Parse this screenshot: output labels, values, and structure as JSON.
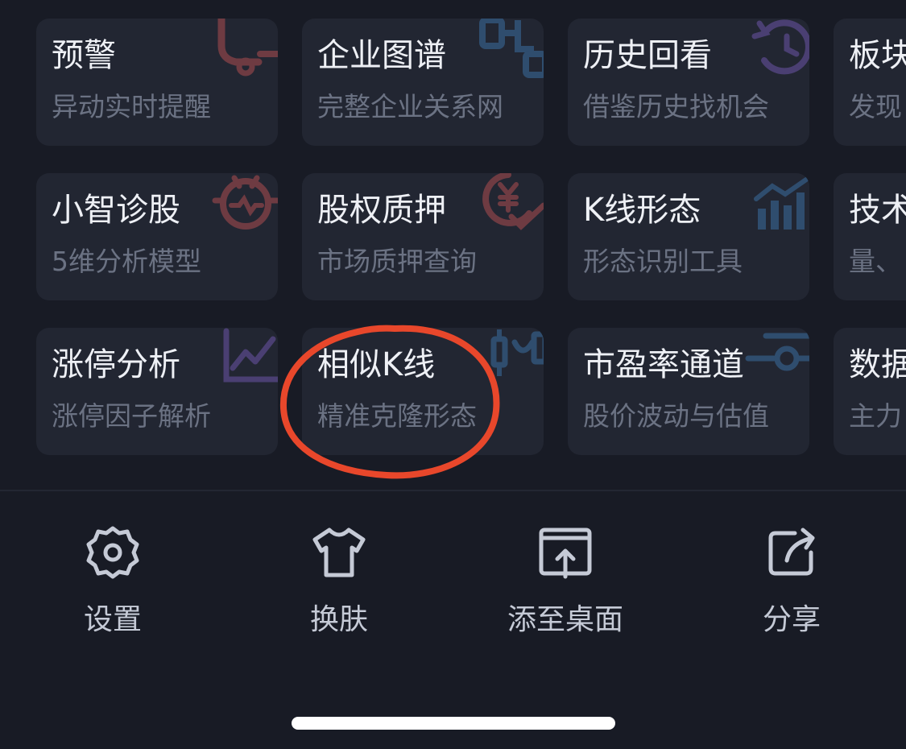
{
  "tools": [
    {
      "title": "预警",
      "subtitle": "异动实时提醒",
      "icon": "bell-icon",
      "icon_color": "#6e3b42"
    },
    {
      "title": "企业图谱",
      "subtitle": "完整企业关系网",
      "icon": "network-graph-icon",
      "icon_color": "#2f4d6e"
    },
    {
      "title": "历史回看",
      "subtitle": "借鉴历史找机会",
      "icon": "history-clock-icon",
      "icon_color": "#4a3f72"
    },
    {
      "title": "板块",
      "subtitle": "发现",
      "icon": "sector-icon",
      "icon_color": "#2f4d6e"
    },
    {
      "title": "小智诊股",
      "subtitle": "5维分析模型",
      "icon": "robot-face-icon",
      "icon_color": "#6e3b42"
    },
    {
      "title": "股权质押",
      "subtitle": "市场质押查询",
      "icon": "yuan-pledge-icon",
      "icon_color": "#6e3b42"
    },
    {
      "title": "K线形态",
      "subtitle": "形态识别工具",
      "icon": "bar-trend-icon",
      "icon_color": "#2f4d6e"
    },
    {
      "title": "技术",
      "subtitle": "量、",
      "icon": "technical-icon",
      "icon_color": "#2f4d6e"
    },
    {
      "title": "涨停分析",
      "subtitle": "涨停因子解析",
      "icon": "line-chart-icon",
      "icon_color": "#4a3f72"
    },
    {
      "title": "相似K线",
      "subtitle": "精准克隆形态",
      "icon": "candlestick-icon",
      "icon_color": "#2f4d6e"
    },
    {
      "title": "市盈率通道",
      "subtitle": "股价波动与估值",
      "icon": "slider-icon",
      "icon_color": "#2f4d6e"
    },
    {
      "title": "数据",
      "subtitle": "主力",
      "icon": "data-icon",
      "icon_color": "#2f4d6e"
    }
  ],
  "actions": [
    {
      "label": "设置",
      "icon": "gear-icon"
    },
    {
      "label": "换肤",
      "icon": "tshirt-icon"
    },
    {
      "label": "添至桌面",
      "icon": "add-to-desktop-icon"
    },
    {
      "label": "分享",
      "icon": "share-icon"
    }
  ],
  "colors": {
    "background": "#181b25",
    "card": "#222632",
    "title": "#eef0f5",
    "subtitle": "#6b7283",
    "action_icon": "#c5cad6",
    "annotation": "#e8472b"
  }
}
